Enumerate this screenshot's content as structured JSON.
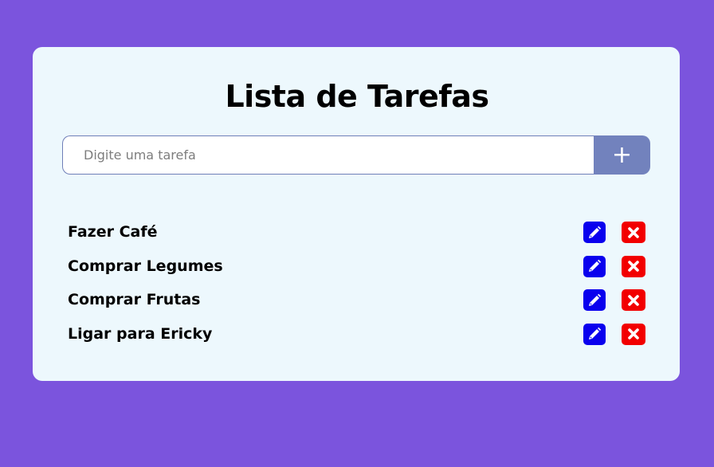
{
  "app": {
    "title": "Lista de Tarefas"
  },
  "input": {
    "placeholder": "Digite uma tarefa",
    "value": ""
  },
  "add_button": {
    "label": "+"
  },
  "tasks": [
    {
      "label": "Fazer Café",
      "edit_icon": "pencil-icon",
      "delete_icon": "close-icon"
    },
    {
      "label": "Comprar Legumes",
      "edit_icon": "pencil-icon",
      "delete_icon": "close-icon"
    },
    {
      "label": "Comprar Frutas",
      "edit_icon": "pencil-icon",
      "delete_icon": "close-icon"
    },
    {
      "label": "Ligar para Ericky",
      "edit_icon": "pencil-icon",
      "delete_icon": "close-icon"
    }
  ],
  "colors": {
    "background": "#7b54dd",
    "card": "#edf8fd",
    "add_button": "#7282bd",
    "edit_button": "#0a00ee",
    "delete_button": "#f20000"
  }
}
